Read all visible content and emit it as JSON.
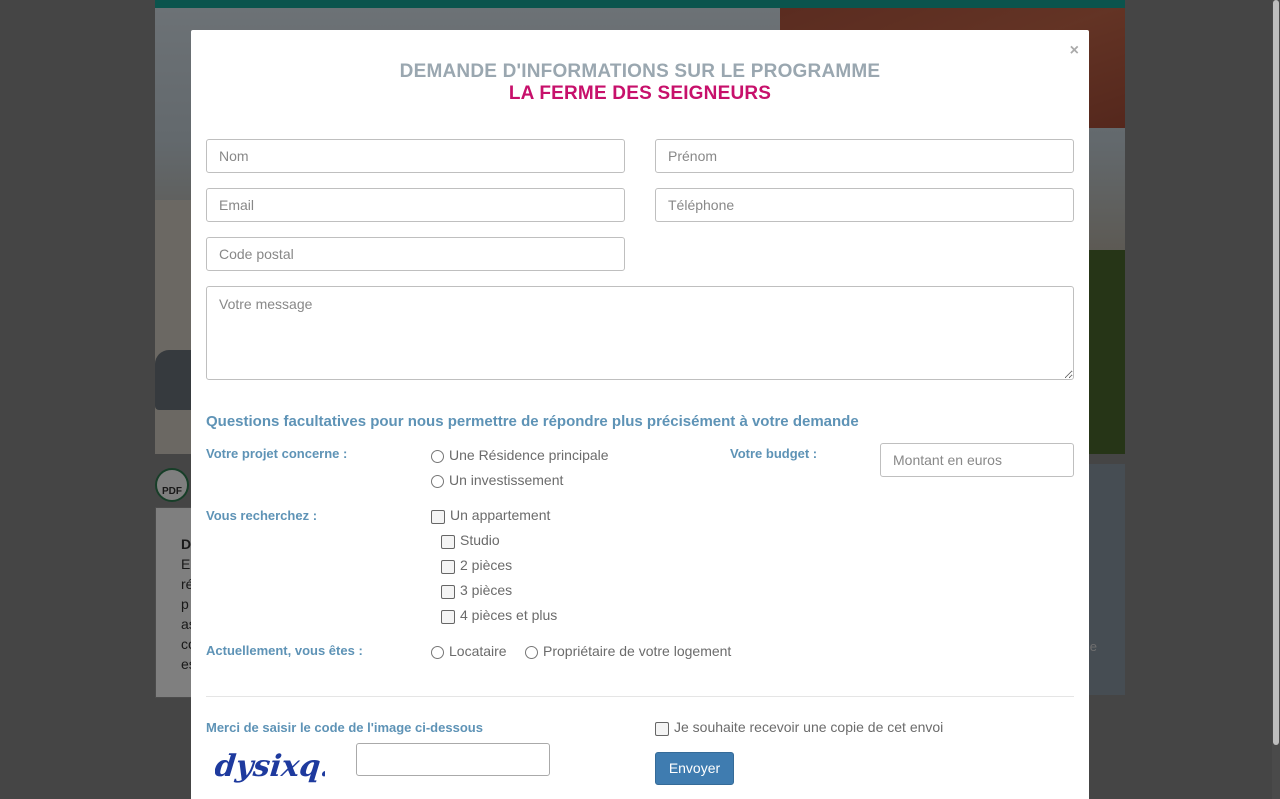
{
  "background": {
    "pdf_icon_label": "PDF",
    "description_snippet": [
      "D",
      "E",
      "ré",
      "p",
      "as",
      "co",
      "es"
    ],
    "panel_text": "e"
  },
  "modal": {
    "close_label": "×",
    "title": "DEMANDE D'INFORMATIONS SUR LE PROGRAMME",
    "program_name": "LA FERME DES SEIGNEURS",
    "fields": {
      "nom_placeholder": "Nom",
      "prenom_placeholder": "Prénom",
      "email_placeholder": "Email",
      "telephone_placeholder": "Téléphone",
      "code_postal_placeholder": "Code postal",
      "message_placeholder": "Votre message"
    },
    "optional_title": "Questions facultatives pour nous permettre de répondre plus précisément à votre demande",
    "projet": {
      "label": "Votre projet concerne :",
      "options": [
        "Une Résidence principale",
        "Un investissement"
      ]
    },
    "budget": {
      "label": "Votre budget :",
      "placeholder": "Montant en euros"
    },
    "recherche": {
      "label": "Vous recherchez :",
      "main_option": "Un appartement",
      "sub_options": [
        "Studio",
        "2 pièces",
        "3 pièces",
        "4 pièces et plus"
      ]
    },
    "statut": {
      "label": "Actuellement, vous êtes :",
      "options": [
        "Locataire",
        "Propriétaire de votre logement"
      ]
    },
    "captcha": {
      "label": "Merci de saisir le code de l'image ci-dessous",
      "image_text": "dysixq.t",
      "input_value": ""
    },
    "copy_checkbox_label": "Je souhaite recevoir une copie de cet envoi",
    "submit_label": "Envoyer"
  },
  "colors": {
    "accent_blue": "#5e93b6",
    "title_grey": "#9aa7b0",
    "program_magenta": "#c7106b",
    "button_blue": "#3f7cb0",
    "topbar_teal": "#16a89a"
  }
}
